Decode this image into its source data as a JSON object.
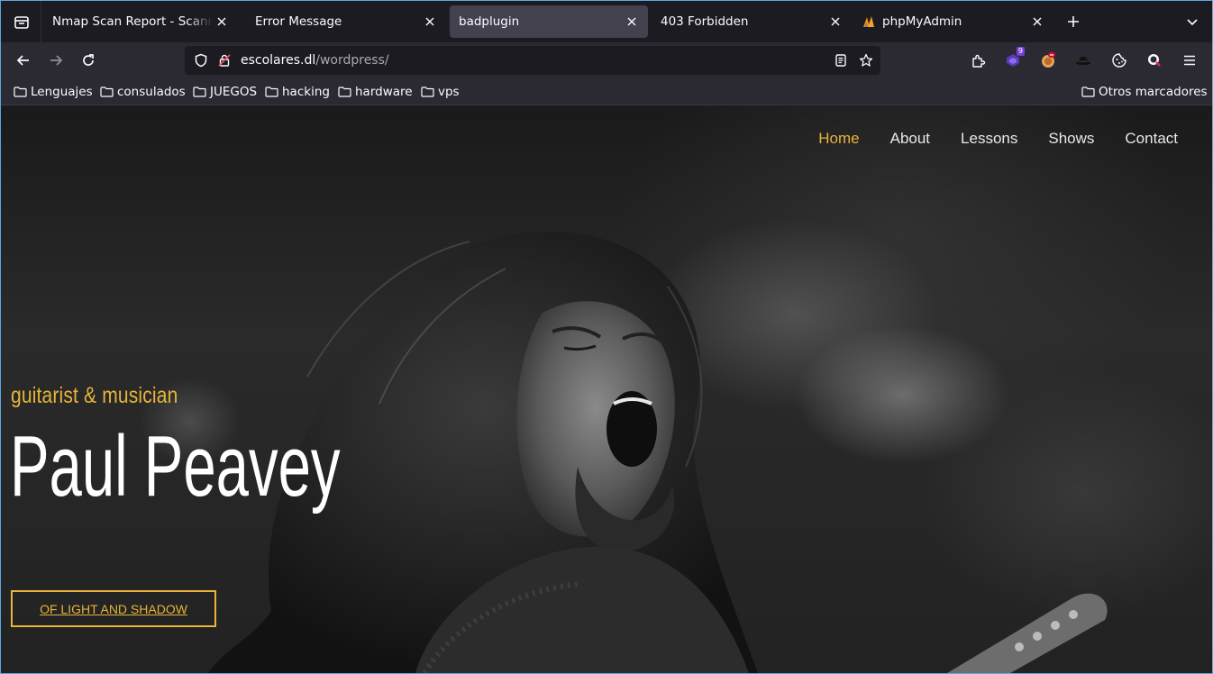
{
  "browser": {
    "tabs": [
      {
        "title": "Nmap Scan Report - Scanned at",
        "active": false
      },
      {
        "title": "Error Message",
        "active": false
      },
      {
        "title": "badplugin",
        "active": true
      },
      {
        "title": "403 Forbidden",
        "active": false
      },
      {
        "title": "phpMyAdmin",
        "active": false
      }
    ],
    "url_host": "escolares.dl",
    "url_path": "/wordpress/",
    "extension_badge": "9",
    "bookmarks": [
      "Lenguajes",
      "consulados",
      "JUEGOS",
      "hacking",
      "hardware",
      "vps"
    ],
    "other_bookmarks": "Otros marcadores"
  },
  "site": {
    "nav": [
      "Home",
      "About",
      "Lessons",
      "Shows",
      "Contact"
    ],
    "subtitle": "guitarist & musician",
    "title": "Paul Peavey",
    "button": "OF LIGHT AND SHADOW"
  },
  "colors": {
    "accent": "#e8b43a",
    "browser_bg": "#1c1b22",
    "toolbar_bg": "#2b2a33",
    "active_tab": "#42414d",
    "window_border": "#5ea7df"
  }
}
